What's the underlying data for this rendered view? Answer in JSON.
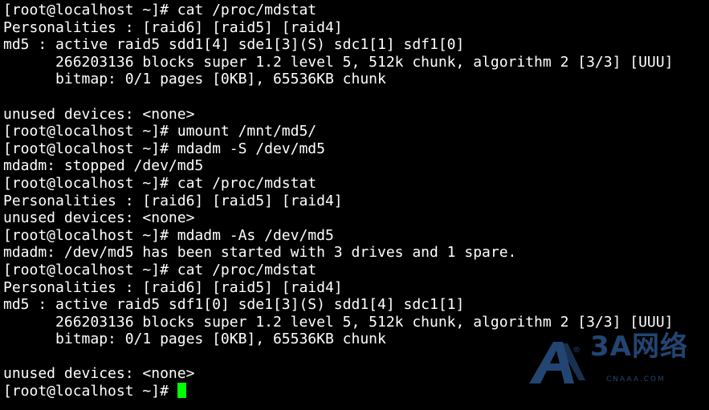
{
  "colors": {
    "background": "#000000",
    "text": "#ffffff",
    "cursor": "#00ff00",
    "watermark": "#3f7fd0"
  },
  "terminal": {
    "lines": [
      "[root@localhost ~]# cat /proc/mdstat",
      "Personalities : [raid6] [raid5] [raid4]",
      "md5 : active raid5 sdd1[4] sde1[3](S) sdc1[1] sdf1[0]",
      "      266203136 blocks super 1.2 level 5, 512k chunk, algorithm 2 [3/3] [UUU]",
      "      bitmap: 0/1 pages [0KB], 65536KB chunk",
      "",
      "unused devices: <none>",
      "[root@localhost ~]# umount /mnt/md5/",
      "[root@localhost ~]# mdadm -S /dev/md5",
      "mdadm: stopped /dev/md5",
      "[root@localhost ~]# cat /proc/mdstat",
      "Personalities : [raid6] [raid5] [raid4]",
      "unused devices: <none>",
      "[root@localhost ~]# mdadm -As /dev/md5",
      "mdadm: /dev/md5 has been started with 3 drives and 1 spare.",
      "[root@localhost ~]# cat /proc/mdstat",
      "Personalities : [raid6] [raid5] [raid4]",
      "md5 : active raid5 sdf1[0] sde1[3](S) sdd1[4] sdc1[1]",
      "      266203136 blocks super 1.2 level 5, 512k chunk, algorithm 2 [3/3] [UUU]",
      "      bitmap: 0/1 pages [0KB], 65536KB chunk",
      "",
      "unused devices: <none>"
    ],
    "prompt": "[root@localhost ~]# "
  },
  "watermark": {
    "brand": "3A网络",
    "registered": "®",
    "domain": "CNAAA.COM",
    "icon": "stylized-a-logo-icon"
  }
}
